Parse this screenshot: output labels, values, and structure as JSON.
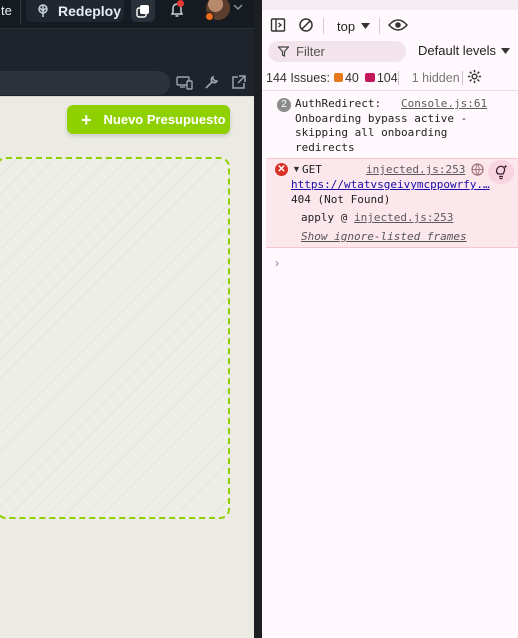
{
  "topbar": {
    "cut_label": "te",
    "redeploy_label": "Redeploy",
    "icons": [
      "redeploy-icon",
      "copy-icon",
      "bell-icon",
      "avatar",
      "chevron-down-icon"
    ]
  },
  "toolbar_icons": [
    "devices-icon",
    "wrench-icon",
    "external-link-icon"
  ],
  "page": {
    "new_budget_plus": "+",
    "new_budget_label": "Nuevo Presupuesto"
  },
  "devtools": {
    "context_label": "top",
    "filter_placeholder": "Filter",
    "levels_label": "Default levels",
    "issues": {
      "label": "144 Issues:",
      "warnings": "40",
      "messages": "104",
      "hidden": "1 hidden"
    },
    "messages": [
      {
        "count": "2",
        "text": "AuthRedirect:\nOnboarding bypass active -\nskipping all onboarding\nredirects",
        "source": "Console.js:61"
      }
    ],
    "error": {
      "method": "GET",
      "source": "injected.js:253",
      "url": "https://wtatvsgeivymcppowrfy.…",
      "status": "404 (Not Found)",
      "stack_fn": "apply @",
      "stack_src": "injected.js:253",
      "show_frames": "Show ignore-listed frames"
    },
    "prompt_glyph": "›"
  },
  "colors": {
    "accent_green": "#8fd000",
    "topbar_bg": "#161b22",
    "error_bg": "#fce8ec",
    "error_red": "#d93025"
  }
}
